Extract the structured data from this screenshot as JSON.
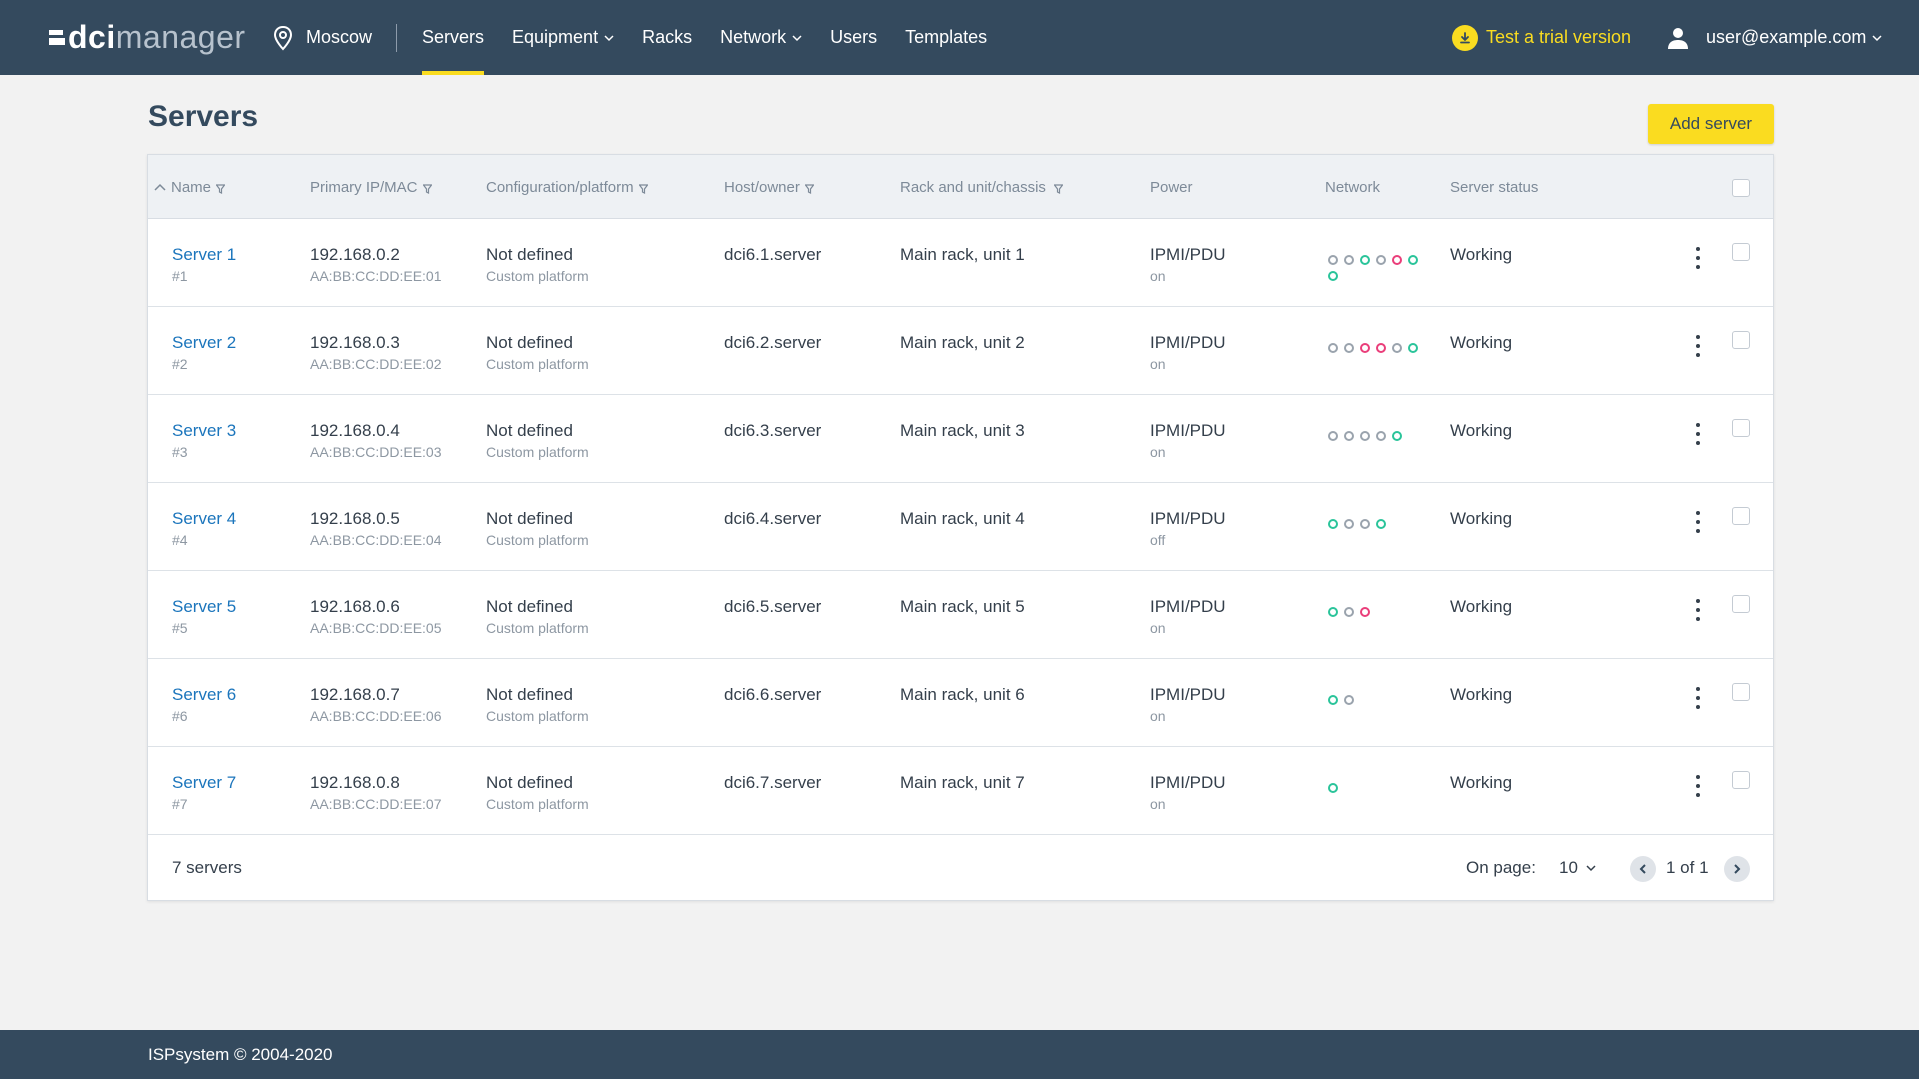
{
  "header": {
    "logo_strong": "dci",
    "logo_light": "manager",
    "location": "Moscow",
    "nav": [
      {
        "label": "Servers",
        "active": true,
        "dropdown": false
      },
      {
        "label": "Equipment",
        "active": false,
        "dropdown": true
      },
      {
        "label": "Racks",
        "active": false,
        "dropdown": false
      },
      {
        "label": "Network",
        "active": false,
        "dropdown": true
      },
      {
        "label": "Users",
        "active": false,
        "dropdown": false
      },
      {
        "label": "Templates",
        "active": false,
        "dropdown": false
      }
    ],
    "trial_label": "Test a trial version",
    "user_email": "user@example.com"
  },
  "page": {
    "title": "Servers",
    "add_button": "Add server"
  },
  "table": {
    "columns": {
      "name": "Name",
      "ip": "Primary IP/MAC",
      "config": "Configuration/platform",
      "host": "Host/owner",
      "rack": "Rack and unit/chassis",
      "power": "Power",
      "network": "Network",
      "status": "Server status"
    },
    "rows": [
      {
        "name": "Server 1",
        "id": "#1",
        "ip": "192.168.0.2",
        "mac": "AA:BB:CC:DD:EE:01",
        "config": "Not defined",
        "platform": "Custom platform",
        "host": "dci6.1.server",
        "rack": "Main rack, unit 1",
        "power": "IPMI/PDU",
        "power_state": "on",
        "ports": [
          "grey",
          "grey",
          "green",
          "grey",
          "red",
          "green",
          "green"
        ],
        "status": "Working"
      },
      {
        "name": "Server 2",
        "id": "#2",
        "ip": "192.168.0.3",
        "mac": "AA:BB:CC:DD:EE:02",
        "config": "Not defined",
        "platform": "Custom platform",
        "host": "dci6.2.server",
        "rack": "Main rack, unit 2",
        "power": "IPMI/PDU",
        "power_state": "on",
        "ports": [
          "grey",
          "grey",
          "red",
          "red",
          "grey",
          "green"
        ],
        "status": "Working"
      },
      {
        "name": "Server 3",
        "id": "#3",
        "ip": "192.168.0.4",
        "mac": "AA:BB:CC:DD:EE:03",
        "config": "Not defined",
        "platform": "Custom platform",
        "host": "dci6.3.server",
        "rack": "Main rack, unit 3",
        "power": "IPMI/PDU",
        "power_state": "on",
        "ports": [
          "grey",
          "grey",
          "grey",
          "grey",
          "green"
        ],
        "status": "Working"
      },
      {
        "name": "Server 4",
        "id": "#4",
        "ip": "192.168.0.5",
        "mac": "AA:BB:CC:DD:EE:04",
        "config": "Not defined",
        "platform": "Custom platform",
        "host": "dci6.4.server",
        "rack": "Main rack, unit 4",
        "power": "IPMI/PDU",
        "power_state": "off",
        "ports": [
          "green",
          "grey",
          "grey",
          "green"
        ],
        "status": "Working"
      },
      {
        "name": "Server 5",
        "id": "#5",
        "ip": "192.168.0.6",
        "mac": "AA:BB:CC:DD:EE:05",
        "config": "Not defined",
        "platform": "Custom platform",
        "host": "dci6.5.server",
        "rack": "Main rack, unit 5",
        "power": "IPMI/PDU",
        "power_state": "on",
        "ports": [
          "green",
          "grey",
          "red"
        ],
        "status": "Working"
      },
      {
        "name": "Server 6",
        "id": "#6",
        "ip": "192.168.0.7",
        "mac": "AA:BB:CC:DD:EE:06",
        "config": "Not defined",
        "platform": "Custom platform",
        "host": "dci6.6.server",
        "rack": "Main rack, unit 6",
        "power": "IPMI/PDU",
        "power_state": "on",
        "ports": [
          "green",
          "grey"
        ],
        "status": "Working"
      },
      {
        "name": "Server 7",
        "id": "#7",
        "ip": "192.168.0.8",
        "mac": "AA:BB:CC:DD:EE:07",
        "config": "Not defined",
        "platform": "Custom platform",
        "host": "dci6.7.server",
        "rack": "Main rack, unit 7",
        "power": "IPMI/PDU",
        "power_state": "on",
        "ports": [
          "green"
        ],
        "status": "Working"
      }
    ],
    "summary": "7 servers",
    "on_page_label": "On page:",
    "per_page": "10",
    "page_info": "1 of 1"
  },
  "footer": {
    "copyright": "ISPsystem © 2004-2020"
  },
  "colors": {
    "header_bg": "#344a5e",
    "accent": "#fadc20",
    "link": "#1b75bc",
    "port_green": "#2ac49a",
    "port_red": "#ea3e7a",
    "port_grey": "#9aa3ad"
  }
}
